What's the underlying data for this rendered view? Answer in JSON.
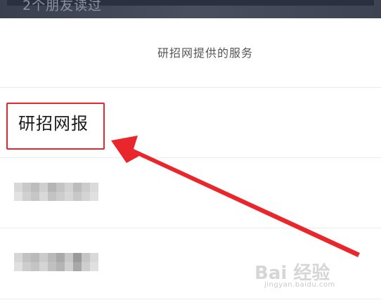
{
  "background_page": {
    "faded_text": "2个朋友读过"
  },
  "sheet": {
    "title": "研招网提供的服务",
    "items": [
      {
        "label": "研招网报",
        "highlighted": true
      },
      {
        "label": "",
        "blurred": true
      },
      {
        "label": "",
        "blurred": true
      }
    ]
  },
  "annotation": {
    "highlight_color": "#e8262b",
    "arrow_color": "#e8262b"
  },
  "watermark": {
    "main_text": "Bai 经验",
    "sub_text": "jingyan.baidu.com"
  }
}
